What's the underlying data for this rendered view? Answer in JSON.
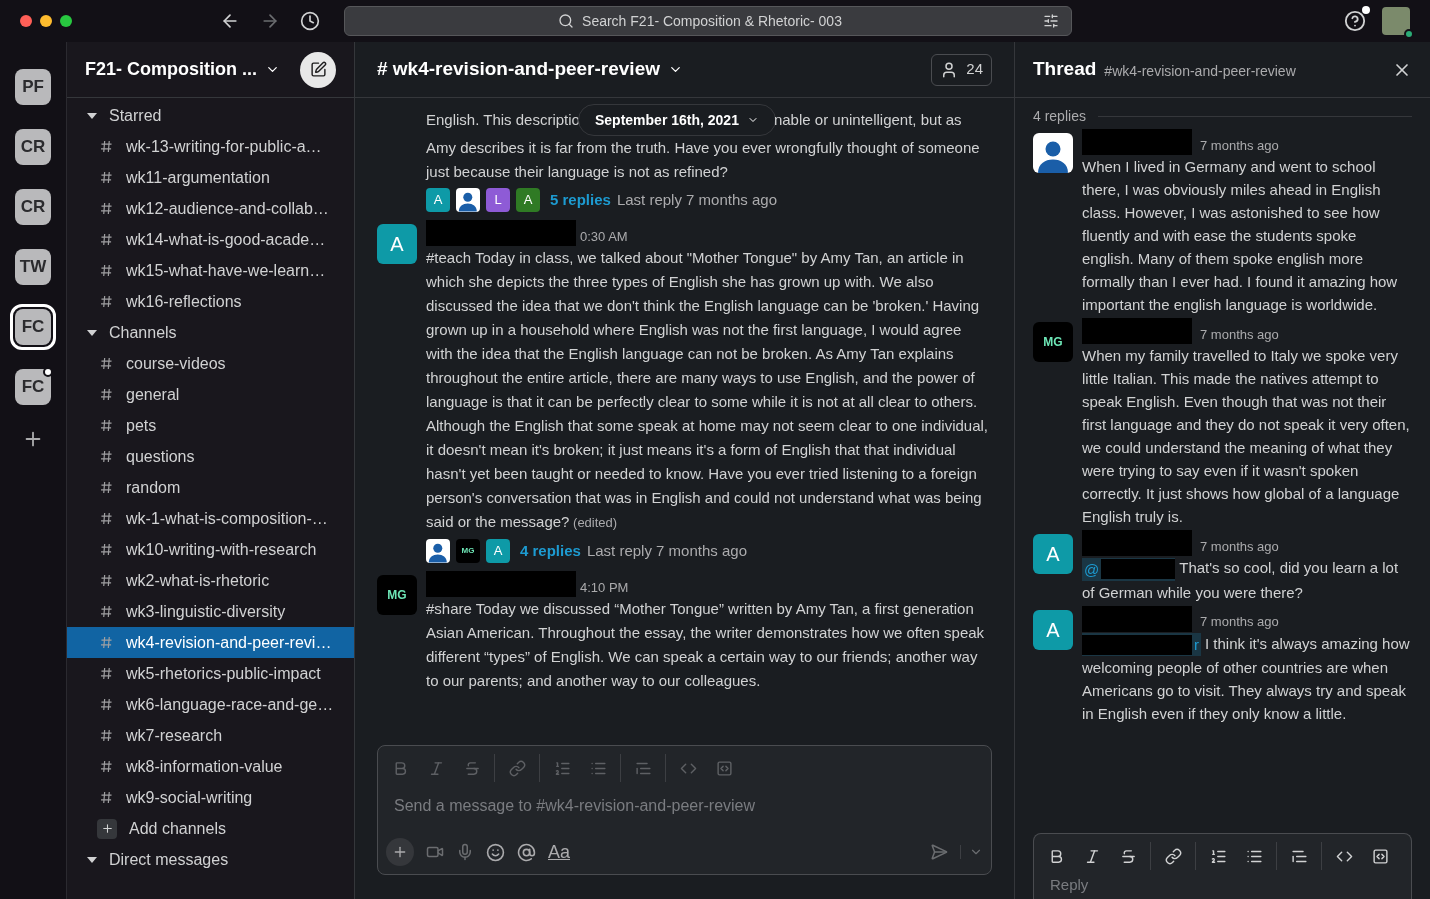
{
  "topbar": {
    "search_placeholder": "Search F21- Composition & Rhetoric- 003",
    "forward_disabled": true,
    "help_unread": true
  },
  "workspaces": [
    {
      "label": "PF",
      "selected": false,
      "unread": false
    },
    {
      "label": "CR",
      "selected": false,
      "unread": false
    },
    {
      "label": "CR",
      "selected": false,
      "unread": false
    },
    {
      "label": "TW",
      "selected": false,
      "unread": false
    },
    {
      "label": "FC",
      "selected": true,
      "unread": false
    },
    {
      "label": "FC",
      "selected": false,
      "unread": true
    }
  ],
  "sidebar": {
    "workspace_name": "F21- Composition ...",
    "sections": [
      {
        "title": "Starred",
        "expanded": true,
        "items": [
          {
            "label": "wk-13-writing-for-public-a…",
            "selected": false
          },
          {
            "label": "wk11-argumentation",
            "selected": false
          },
          {
            "label": "wk12-audience-and-collab…",
            "selected": false
          },
          {
            "label": "wk14-what-is-good-acade…",
            "selected": false
          },
          {
            "label": "wk15-what-have-we-learn…",
            "selected": false
          },
          {
            "label": "wk16-reflections",
            "selected": false
          }
        ]
      },
      {
        "title": "Channels",
        "expanded": true,
        "add_label": "Add channels",
        "items": [
          {
            "label": "course-videos",
            "selected": false
          },
          {
            "label": "general",
            "selected": false
          },
          {
            "label": "pets",
            "selected": false
          },
          {
            "label": "questions",
            "selected": false
          },
          {
            "label": "random",
            "selected": false
          },
          {
            "label": "wk-1-what-is-composition-…",
            "selected": false
          },
          {
            "label": "wk10-writing-with-research",
            "selected": false
          },
          {
            "label": "wk2-what-is-rhetoric",
            "selected": false
          },
          {
            "label": "wk3-linguistic-diversity",
            "selected": false
          },
          {
            "label": "wk4-revision-and-peer-revi…",
            "selected": true
          },
          {
            "label": "wk5-rhetorics-public-impact",
            "selected": false
          },
          {
            "label": "wk6-language-race-and-ge…",
            "selected": false
          },
          {
            "label": "wk7-research",
            "selected": false
          },
          {
            "label": "wk8-information-value",
            "selected": false
          },
          {
            "label": "wk9-social-writing",
            "selected": false
          }
        ]
      },
      {
        "title": "Direct messages",
        "expanded": true
      }
    ]
  },
  "channel": {
    "title": "# wk4-revision-and-peer-review",
    "member_count": "24",
    "top_message": {
      "text_before_date": "English. This descriptio",
      "date_label": "September 16th, 2021",
      "text_after_date": "nable or unintelligent, but as",
      "text": "Amy describes it is far from the truth. Have you ever wrongfully thought of someone just because their language is not as refined?",
      "reply_avatars": [
        {
          "kind": "letter",
          "text": "A",
          "color": "#0e9aa7"
        },
        {
          "kind": "person"
        },
        {
          "kind": "letter",
          "text": "L",
          "color": "#8e5bd6"
        },
        {
          "kind": "letter",
          "text": "A",
          "color": "#2f7a24"
        }
      ],
      "replies": "5 replies",
      "last_reply": "Last reply 7 months ago"
    },
    "messages": [
      {
        "avatar": {
          "kind": "letter",
          "text": "A",
          "color": "#0e9aa7"
        },
        "time": "0:30 AM",
        "text": "#teach Today in class, we talked about \"Mother Tongue\" by Amy Tan, an article in which she depicts the three types of English she has grown up with. We also discussed the idea that we don't think the English language can be 'broken.' Having grown up in a household where English was not the first language, I would agree with the idea that the English language can not be broken. As Amy Tan explains throughout the entire article, there are many ways to use English, and the power of language is that it can be perfectly clear to some while it is not at all clear to others. Although the English that some speak at home may not seem clear to one individual, it doesn't mean it's broken; it just means it's a form of English that that individual hasn't yet been taught or needed to know. Have you ever tried listening to a foreign person's conversation that was in English and could not understand what was being said or the message?",
        "edited": "(edited)",
        "reply_avatars": [
          {
            "kind": "person"
          },
          {
            "kind": "logo",
            "text": "MG"
          },
          {
            "kind": "letter",
            "text": "A",
            "color": "#0e9aa7"
          }
        ],
        "replies": "4 replies",
        "last_reply": "Last reply 7 months ago"
      },
      {
        "avatar": {
          "kind": "logo",
          "text": "MG"
        },
        "time": "4:10 PM",
        "text": "#share Today we discussed “Mother Tongue” written by Amy Tan, a first generation Asian American. Throughout the essay, the writer demonstrates how we often speak different “types” of English. We can speak a certain way to our friends; another way to our parents; and another way to our colleagues."
      }
    ],
    "composer": {
      "placeholder": "Send a message to #wk4-revision-and-peer-review",
      "format_label": "Aa"
    }
  },
  "thread": {
    "title": "Thread",
    "channel": "#wk4-revision-and-peer-review",
    "reply_count": "4 replies",
    "messages": [
      {
        "avatar": {
          "kind": "person"
        },
        "time": "7 months ago",
        "text": "When I lived in Germany and went to school there, I was obviously miles ahead in English class. However, I was astonished to see how fluently and with ease the students spoke english. Many of them spoke english more formally than I ever had. I found it amazing how important the english language is worldwide."
      },
      {
        "avatar": {
          "kind": "logo",
          "text": "MG"
        },
        "time": "7 months ago",
        "text": "When my family travelled to Italy we spoke very little Italian. This made the natives attempt to speak English. Even though that was not their first language and they do not speak it very often, we could understand the meaning of what they were trying to say even if it wasn't spoken correctly. It just shows how global of a language English truly is."
      },
      {
        "avatar": {
          "kind": "letter",
          "text": "A",
          "color": "#0e9aa7"
        },
        "time": "7 months ago",
        "mention": {
          "kind": "leading",
          "text": "@"
        },
        "text": "That's so cool, did you learn a lot of German while you were there?"
      },
      {
        "avatar": {
          "kind": "letter",
          "text": "A",
          "color": "#0e9aa7"
        },
        "time": "7 months ago",
        "mention": {
          "kind": "trailing",
          "text": "r"
        },
        "text": "I think it's always amazing how welcoming people of other countries are when Americans go to visit. They always try and speak in English even if they only know a little."
      }
    ],
    "composer": {
      "placeholder": "Reply"
    }
  }
}
